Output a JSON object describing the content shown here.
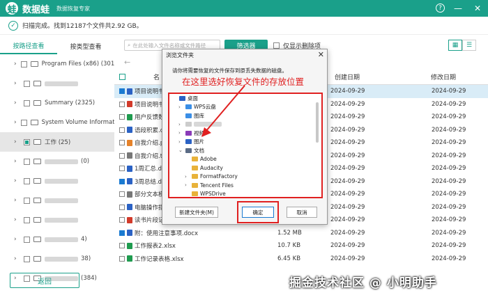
{
  "app": {
    "name": "数据蛙",
    "subtitle": "数据恢复专家",
    "logo": "蛙",
    "accent": "#1aa08a"
  },
  "window_controls": {
    "help": "?",
    "minimize": "—",
    "close": "✕"
  },
  "status": {
    "text": "扫描完成。找到12187个文件共2.92 GB。"
  },
  "tabs": [
    {
      "label": "按路径查看"
    },
    {
      "label": "按类型查看"
    }
  ],
  "tree": [
    {
      "label": "Program Files (x86) (3010",
      "blurred": false
    },
    {
      "label": "",
      "blurred": true
    },
    {
      "label": "Summary (2325)",
      "blurred": false
    },
    {
      "label": "System Volume Informati",
      "blurred": false
    },
    {
      "label": "工作 (25)",
      "blurred": false,
      "selected": true
    },
    {
      "label": "(0)",
      "blurred": true
    },
    {
      "label": "",
      "blurred": true
    },
    {
      "label": "",
      "blurred": true
    },
    {
      "label": "",
      "blurred": true
    },
    {
      "label": "4)",
      "blurred": true
    },
    {
      "label": "38)",
      "blurred": true
    },
    {
      "label": "(384)",
      "blurred": true
    }
  ],
  "search": {
    "placeholder": "在此处输入文件名称或文件路径"
  },
  "filter_button": "筛选器",
  "only_deleted": "仅显示删除项",
  "view_icons": [
    "grid-icon",
    "list-icon"
  ],
  "table": {
    "headers": {
      "name": "名",
      "created": "创建日期",
      "modified": "修改日期"
    },
    "rows": [
      {
        "name": "项目说明书",
        "size": "",
        "created": "2024-09-29",
        "modified": "2024-09-29",
        "checked": true,
        "selected": true,
        "color": "#2b62c4"
      },
      {
        "name": "项目说明书",
        "size": "",
        "created": "2024-09-29",
        "modified": "2024-09-29",
        "checked": false,
        "color": "#d23a2a"
      },
      {
        "name": "用户反馈数",
        "size": "",
        "created": "2024-09-29",
        "modified": "2024-09-29",
        "checked": false,
        "color": "#1f9b4f"
      },
      {
        "name": "语段积累.d",
        "size": "",
        "created": "2024-09-29",
        "modified": "2024-09-29",
        "checked": false,
        "color": "#2b62c4"
      },
      {
        "name": "自我介绍.p",
        "size": "",
        "created": "2024-09-29",
        "modified": "2024-09-29",
        "checked": false,
        "color": "#e5822a"
      },
      {
        "name": "自我介绍.t",
        "size": "",
        "created": "2024-09-29",
        "modified": "2024-09-29",
        "checked": false,
        "color": "#777777"
      },
      {
        "name": "1周汇总.do",
        "size": "",
        "created": "2024-09-29",
        "modified": "2024-09-29",
        "checked": false,
        "color": "#2b62c4"
      },
      {
        "name": "3周总结.do",
        "size": "",
        "created": "2024-09-29",
        "modified": "2024-09-29",
        "checked": true,
        "color": "#2b62c4"
      },
      {
        "name": "部分文本模",
        "size": "",
        "created": "2024-09-29",
        "modified": "2024-09-29",
        "checked": false,
        "color": "#777777"
      },
      {
        "name": "电脑操作指",
        "size": "",
        "created": "2024-09-29",
        "modified": "2024-09-29",
        "checked": false,
        "color": "#2b62c4"
      },
      {
        "name": "读书片段记录.pdf",
        "size": "",
        "created": "2024-09-29",
        "modified": "2024-09-29",
        "checked": false,
        "color": "#d23a2a"
      },
      {
        "name": "附：使用注意事项.docx",
        "size": "1.52 MB",
        "created": "2024-09-29",
        "modified": "2024-09-29",
        "checked": true,
        "color": "#2b62c4"
      },
      {
        "name": "工作报表2.xlsx",
        "size": "10.7 KB",
        "created": "2024-09-29",
        "modified": "2024-09-29",
        "checked": false,
        "color": "#1f9b4f"
      },
      {
        "name": "工作记录表格.xlsx",
        "size": "6.45 KB",
        "created": "2024-09-29",
        "modified": "2024-09-29",
        "checked": false,
        "color": "#1f9b4f"
      }
    ]
  },
  "back_button": "返回",
  "watermark": "掘金技术社区 @ 小明助手",
  "dialog": {
    "title": "浏览文件夹",
    "message": "请你将需要恢复的文件保存到原丢失数据的磁盘。",
    "tip": "在这里选好恢复文件的存放位置",
    "items": [
      {
        "label": "桌面",
        "indent": 0,
        "chev": "",
        "color": "#2b62c4"
      },
      {
        "label": "WPS云盘",
        "indent": 1,
        "chev": "›",
        "color": "#3a8ee6"
      },
      {
        "label": "图库",
        "indent": 1,
        "chev": "",
        "color": "#3a8ee6"
      },
      {
        "label": "",
        "indent": 1,
        "chev": "›",
        "color": "#cccccc",
        "blurred": true
      },
      {
        "label": "视频",
        "indent": 1,
        "chev": "›",
        "color": "#8a3bb8"
      },
      {
        "label": "图片",
        "indent": 1,
        "chev": "›",
        "color": "#2b62c4"
      },
      {
        "label": "文档",
        "indent": 1,
        "chev": "⌄",
        "color": "#5b6b85"
      },
      {
        "label": "Adobe",
        "indent": 2,
        "chev": "",
        "color": "#e8b23a"
      },
      {
        "label": "Audacity",
        "indent": 2,
        "chev": "",
        "color": "#e8b23a"
      },
      {
        "label": "FormatFactory",
        "indent": 2,
        "chev": "›",
        "color": "#e8b23a"
      },
      {
        "label": "Tencent Files",
        "indent": 2,
        "chev": "›",
        "color": "#e8b23a"
      },
      {
        "label": "WPSDrive",
        "indent": 2,
        "chev": "",
        "color": "#e8b23a"
      }
    ],
    "new_folder": "新建文件夹(M)",
    "ok": "确定",
    "cancel": "取消"
  }
}
